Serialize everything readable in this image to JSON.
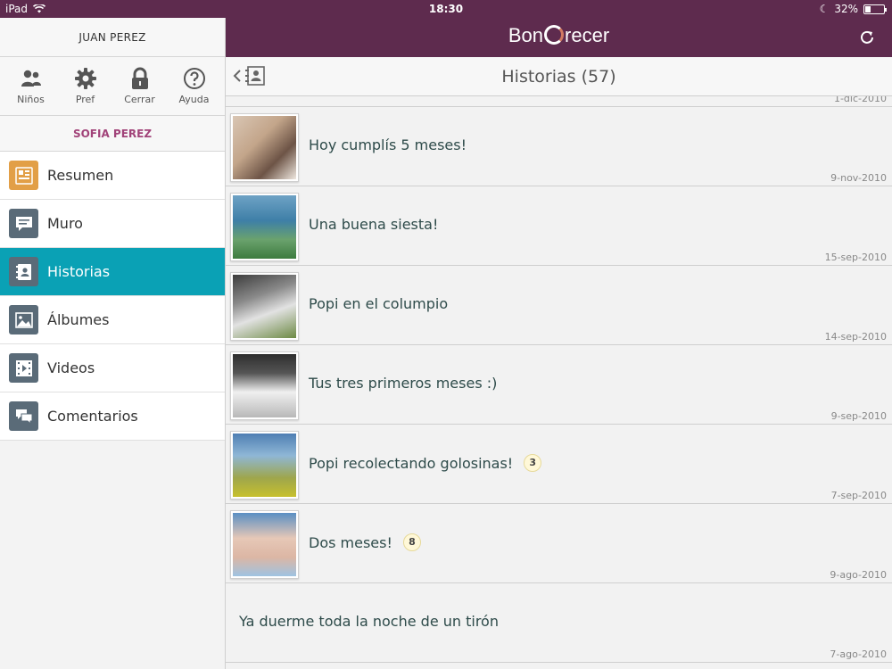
{
  "statusbar": {
    "device": "iPad",
    "time": "18:30",
    "battery": "32%",
    "battery_level": 0.32
  },
  "sidebar": {
    "user_name": "JUAN PEREZ",
    "tools": [
      {
        "label": "Niños",
        "icon": "children-icon"
      },
      {
        "label": "Pref",
        "icon": "gear-icon"
      },
      {
        "label": "Cerrar",
        "icon": "lock-icon"
      },
      {
        "label": "Ayuda",
        "icon": "help-icon"
      }
    ],
    "child_name": "SOFIA PEREZ",
    "menu": [
      {
        "label": "Resumen",
        "icon": "summary-icon"
      },
      {
        "label": "Muro",
        "icon": "wall-icon"
      },
      {
        "label": "Historias",
        "icon": "stories-icon",
        "active": true
      },
      {
        "label": "Álbumes",
        "icon": "albums-icon"
      },
      {
        "label": "Videos",
        "icon": "videos-icon"
      },
      {
        "label": "Comentarios",
        "icon": "comments-icon"
      }
    ]
  },
  "appbar": {
    "logo_text_1": "Bon",
    "logo_text_2": "recer"
  },
  "header": {
    "title": "Historias (57)"
  },
  "colors": {
    "brand": "#5e2b4e",
    "active": "#0aa1b5",
    "accent": "#a14379"
  },
  "stories": {
    "previous_date": "1-dic-2010",
    "items": [
      {
        "title": "Hoy cumplís 5 meses!",
        "date": "9-nov-2010",
        "badge": null
      },
      {
        "title": "Una buena siesta!",
        "date": "15-sep-2010",
        "badge": null
      },
      {
        "title": "Popi en el columpio",
        "date": "14-sep-2010",
        "badge": null
      },
      {
        "title": "Tus tres primeros meses :)",
        "date": "9-sep-2010",
        "badge": null
      },
      {
        "title": "Popi recolectando golosinas!",
        "date": "7-sep-2010",
        "badge": "3"
      },
      {
        "title": "Dos meses!",
        "date": "9-ago-2010",
        "badge": "8"
      },
      {
        "title": "Ya duerme toda la noche de un tirón",
        "date": "7-ago-2010",
        "badge": null
      }
    ]
  }
}
